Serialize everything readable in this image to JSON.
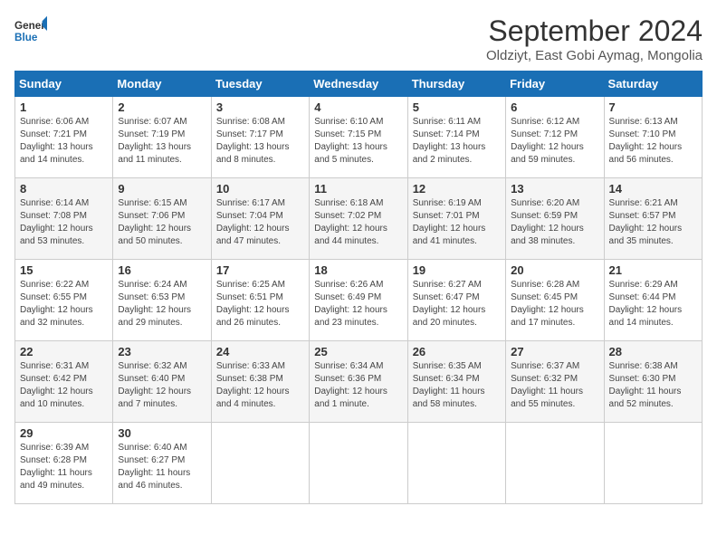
{
  "header": {
    "logo_general": "General",
    "logo_blue": "Blue",
    "month_year": "September 2024",
    "location": "Oldziyt, East Gobi Aymag, Mongolia"
  },
  "days_of_week": [
    "Sunday",
    "Monday",
    "Tuesday",
    "Wednesday",
    "Thursday",
    "Friday",
    "Saturday"
  ],
  "weeks": [
    [
      {
        "day": 1,
        "sunrise": "6:06 AM",
        "sunset": "7:21 PM",
        "daylight": "13 hours and 14 minutes."
      },
      {
        "day": 2,
        "sunrise": "6:07 AM",
        "sunset": "7:19 PM",
        "daylight": "13 hours and 11 minutes."
      },
      {
        "day": 3,
        "sunrise": "6:08 AM",
        "sunset": "7:17 PM",
        "daylight": "13 hours and 8 minutes."
      },
      {
        "day": 4,
        "sunrise": "6:10 AM",
        "sunset": "7:15 PM",
        "daylight": "13 hours and 5 minutes."
      },
      {
        "day": 5,
        "sunrise": "6:11 AM",
        "sunset": "7:14 PM",
        "daylight": "13 hours and 2 minutes."
      },
      {
        "day": 6,
        "sunrise": "6:12 AM",
        "sunset": "7:12 PM",
        "daylight": "12 hours and 59 minutes."
      },
      {
        "day": 7,
        "sunrise": "6:13 AM",
        "sunset": "7:10 PM",
        "daylight": "12 hours and 56 minutes."
      }
    ],
    [
      {
        "day": 8,
        "sunrise": "6:14 AM",
        "sunset": "7:08 PM",
        "daylight": "12 hours and 53 minutes."
      },
      {
        "day": 9,
        "sunrise": "6:15 AM",
        "sunset": "7:06 PM",
        "daylight": "12 hours and 50 minutes."
      },
      {
        "day": 10,
        "sunrise": "6:17 AM",
        "sunset": "7:04 PM",
        "daylight": "12 hours and 47 minutes."
      },
      {
        "day": 11,
        "sunrise": "6:18 AM",
        "sunset": "7:02 PM",
        "daylight": "12 hours and 44 minutes."
      },
      {
        "day": 12,
        "sunrise": "6:19 AM",
        "sunset": "7:01 PM",
        "daylight": "12 hours and 41 minutes."
      },
      {
        "day": 13,
        "sunrise": "6:20 AM",
        "sunset": "6:59 PM",
        "daylight": "12 hours and 38 minutes."
      },
      {
        "day": 14,
        "sunrise": "6:21 AM",
        "sunset": "6:57 PM",
        "daylight": "12 hours and 35 minutes."
      }
    ],
    [
      {
        "day": 15,
        "sunrise": "6:22 AM",
        "sunset": "6:55 PM",
        "daylight": "12 hours and 32 minutes."
      },
      {
        "day": 16,
        "sunrise": "6:24 AM",
        "sunset": "6:53 PM",
        "daylight": "12 hours and 29 minutes."
      },
      {
        "day": 17,
        "sunrise": "6:25 AM",
        "sunset": "6:51 PM",
        "daylight": "12 hours and 26 minutes."
      },
      {
        "day": 18,
        "sunrise": "6:26 AM",
        "sunset": "6:49 PM",
        "daylight": "12 hours and 23 minutes."
      },
      {
        "day": 19,
        "sunrise": "6:27 AM",
        "sunset": "6:47 PM",
        "daylight": "12 hours and 20 minutes."
      },
      {
        "day": 20,
        "sunrise": "6:28 AM",
        "sunset": "6:45 PM",
        "daylight": "12 hours and 17 minutes."
      },
      {
        "day": 21,
        "sunrise": "6:29 AM",
        "sunset": "6:44 PM",
        "daylight": "12 hours and 14 minutes."
      }
    ],
    [
      {
        "day": 22,
        "sunrise": "6:31 AM",
        "sunset": "6:42 PM",
        "daylight": "12 hours and 10 minutes."
      },
      {
        "day": 23,
        "sunrise": "6:32 AM",
        "sunset": "6:40 PM",
        "daylight": "12 hours and 7 minutes."
      },
      {
        "day": 24,
        "sunrise": "6:33 AM",
        "sunset": "6:38 PM",
        "daylight": "12 hours and 4 minutes."
      },
      {
        "day": 25,
        "sunrise": "6:34 AM",
        "sunset": "6:36 PM",
        "daylight": "12 hours and 1 minute."
      },
      {
        "day": 26,
        "sunrise": "6:35 AM",
        "sunset": "6:34 PM",
        "daylight": "11 hours and 58 minutes."
      },
      {
        "day": 27,
        "sunrise": "6:37 AM",
        "sunset": "6:32 PM",
        "daylight": "11 hours and 55 minutes."
      },
      {
        "day": 28,
        "sunrise": "6:38 AM",
        "sunset": "6:30 PM",
        "daylight": "11 hours and 52 minutes."
      }
    ],
    [
      {
        "day": 29,
        "sunrise": "6:39 AM",
        "sunset": "6:28 PM",
        "daylight": "11 hours and 49 minutes."
      },
      {
        "day": 30,
        "sunrise": "6:40 AM",
        "sunset": "6:27 PM",
        "daylight": "11 hours and 46 minutes."
      },
      null,
      null,
      null,
      null,
      null
    ]
  ]
}
